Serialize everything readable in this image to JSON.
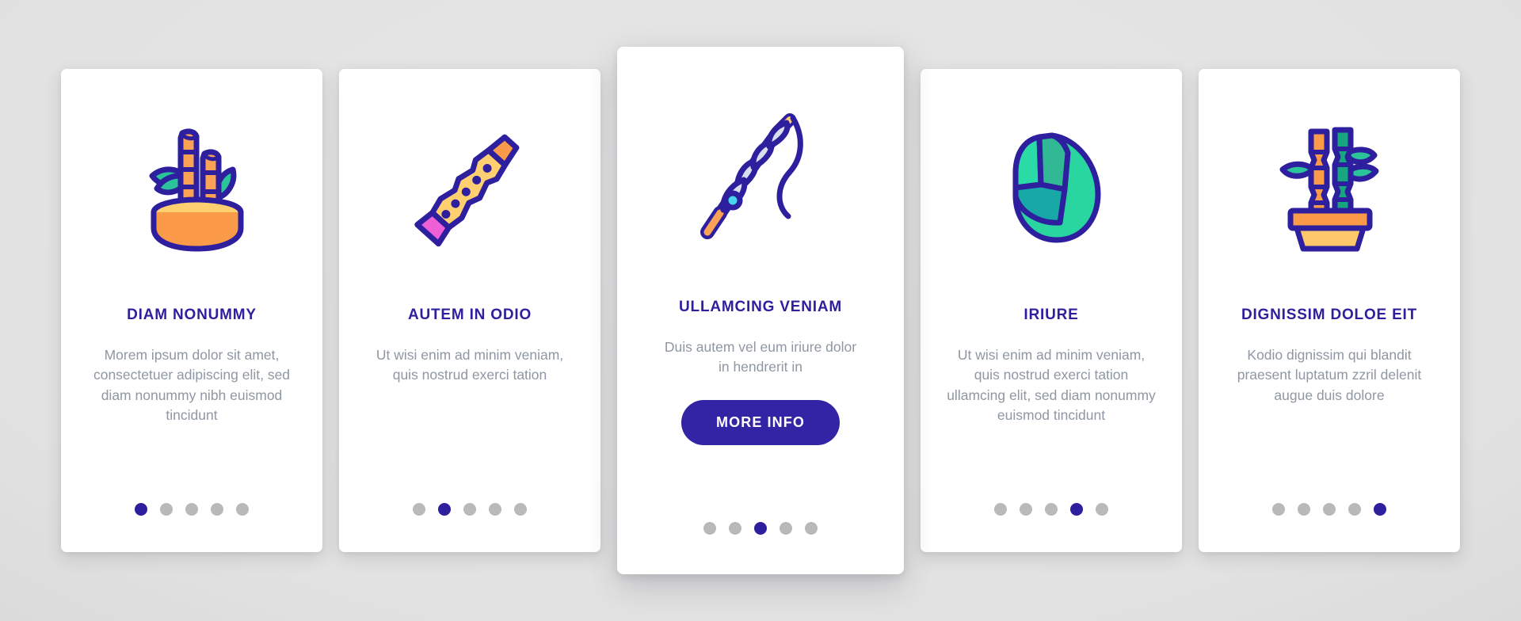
{
  "theme": {
    "accent": "#2d1f9e",
    "button_bg": "#3323a5",
    "body_text": "#8e97a3",
    "dot_inactive": "#b9b9b9",
    "card_bg": "#ffffff",
    "page_bg": "#e0e0e0"
  },
  "cards": [
    {
      "icon": "bamboo-bowl-icon",
      "title": "DIAM NONUMMY",
      "body": "Morem ipsum dolor sit amet, consectetuer adipiscing elit, sed diam nonummy nibh euismod tincidunt",
      "dots_total": 5,
      "dots_active_index": 0,
      "featured": false
    },
    {
      "icon": "flute-icon",
      "title": "AUTEM IN ODIO",
      "body": "Ut wisi enim ad minim veniam, quis nostrud exerci tation",
      "dots_total": 5,
      "dots_active_index": 1,
      "featured": false
    },
    {
      "icon": "fishing-rod-icon",
      "title": "ULLAMCING VENIAM",
      "body": "Duis autem vel eum iriure dolor in hendrerit in",
      "button_label": "MORE INFO",
      "dots_total": 5,
      "dots_active_index": 2,
      "featured": true
    },
    {
      "icon": "leaf-icon",
      "title": "IRIURE",
      "body": "Ut wisi enim ad minim veniam, quis nostrud exerci tation ullamcing elit, sed diam nonummy euismod tincidunt",
      "dots_total": 5,
      "dots_active_index": 3,
      "featured": false
    },
    {
      "icon": "potted-bamboo-icon",
      "title": "DIGNISSIM DOLOE EIT",
      "body": "Kodio dignissim qui blandit praesent luptatum zzril delenit augue duis dolore",
      "dots_total": 5,
      "dots_active_index": 4,
      "featured": false
    }
  ]
}
